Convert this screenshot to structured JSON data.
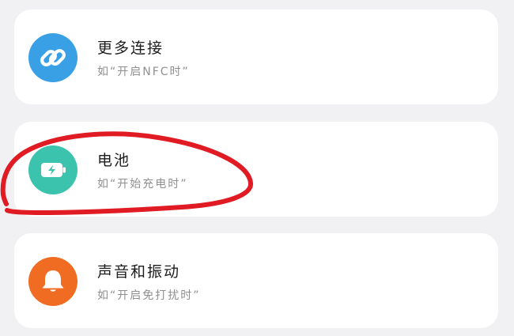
{
  "colors": {
    "background": "#f1f1f3",
    "card": "#ffffff",
    "connections_icon_bg": "#3aa0e6",
    "battery_icon_bg": "#3cc3ae",
    "sound_icon_bg": "#f06c22",
    "annotation_stroke": "#e11b24"
  },
  "items": [
    {
      "icon": "link-icon",
      "title": "更多连接",
      "subtitle": "如“开启NFC时”"
    },
    {
      "icon": "battery-icon",
      "title": "电池",
      "subtitle": "如“开始充电时”"
    },
    {
      "icon": "bell-icon",
      "title": "声音和振动",
      "subtitle": "如“开启免打扰时”"
    }
  ]
}
